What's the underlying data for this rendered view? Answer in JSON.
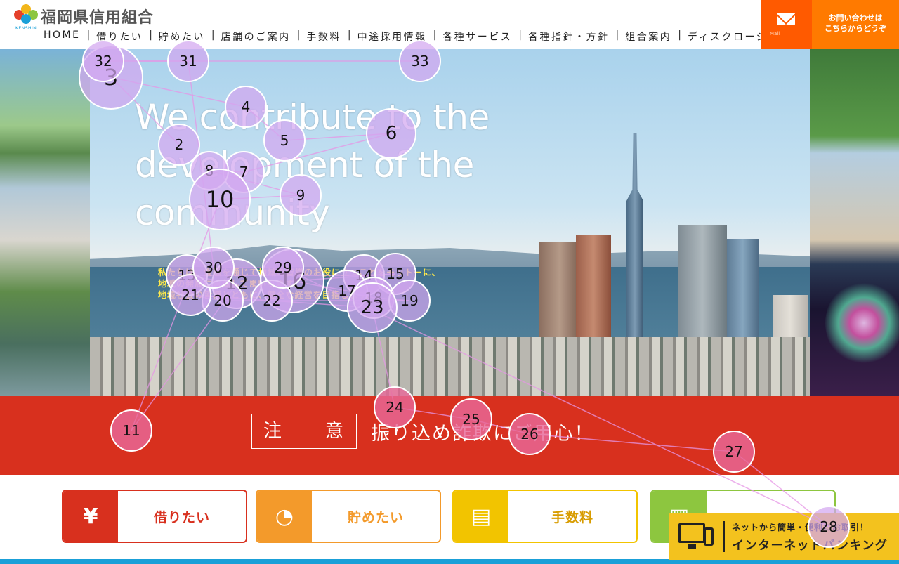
{
  "brand": {
    "name": "福岡県信用組合",
    "logo_sub": "KENSHIN",
    "colors": {
      "red": "#d8301e",
      "orange": "#f39a2b",
      "yellow": "#f2c400",
      "green": "#8dc63f",
      "blue": "#1aa0d8",
      "contact": "#ff7a00"
    }
  },
  "nav": {
    "items": [
      "HOME",
      "借りたい",
      "貯めたい",
      "店舗のご案内",
      "手数料",
      "中途採用情報",
      "各種サービス",
      "各種指針・方針",
      "組合案内",
      "ディスクロージャー"
    ]
  },
  "header": {
    "mail_icon": "mail-icon",
    "mail_label": "Mail",
    "contact_line1": "お問い合わせは",
    "contact_line2": "こちらからどうぞ"
  },
  "hero": {
    "title_line1": "We contribute to the",
    "title_line2": "development of the",
    "title_line3": "community",
    "sub_line1": "私たちは、金融を通じて地域の皆様のお役に立つことをモットーに、",
    "sub_line2": "地域の発展に貢献してまいります。",
    "sub_line3": "地域社会の皆様とともに、健全な経営を目指します。"
  },
  "alert": {
    "label": "注　意",
    "text": "振り込め詐欺にご用心！"
  },
  "services": [
    {
      "label": "借りたい",
      "icon": "house-yen-icon",
      "glyph": "¥"
    },
    {
      "label": "貯めたい",
      "icon": "piggy-bank-icon",
      "glyph": "◔"
    },
    {
      "label": "手数料",
      "icon": "atm-icon",
      "glyph": "▤"
    },
    {
      "label": "",
      "icon": "document-icon",
      "glyph": "▦"
    }
  ],
  "netbank": {
    "line1": "ネットから簡単・便利にお取引！",
    "line2": "インターネットバンキング",
    "icon": "pc-phone-icon"
  },
  "markers": [
    "2",
    "3",
    "4",
    "5",
    "6",
    "7",
    "8",
    "9",
    "10",
    "11",
    "12",
    "13",
    "14",
    "15",
    "16",
    "17",
    "18",
    "19",
    "20",
    "21",
    "22",
    "23",
    "24",
    "25",
    "26",
    "27",
    "28",
    "29",
    "30",
    "31",
    "32",
    "33"
  ]
}
